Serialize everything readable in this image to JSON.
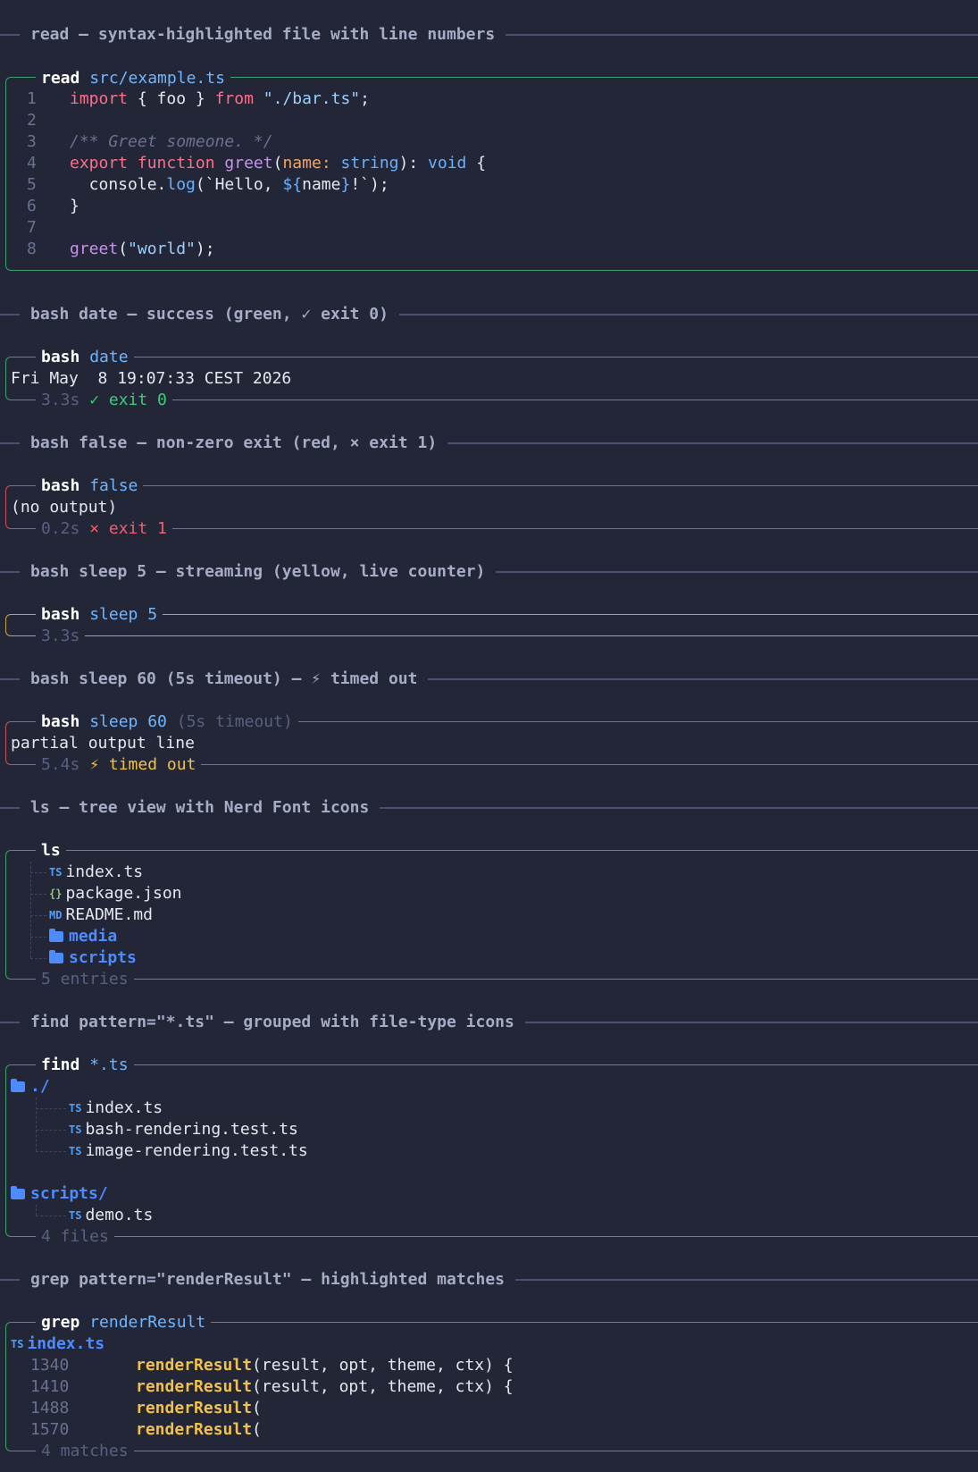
{
  "sections": {
    "read": "read — syntax-highlighted file with line numbers",
    "bash_date": "bash date — success (green, ✓ exit 0)",
    "bash_false": "bash false — non-zero exit (red, × exit 1)",
    "bash_sleep5": "bash sleep 5 — streaming (yellow, live counter)",
    "bash_sleep60": "bash sleep 60 (5s timeout) — ⚡ timed out",
    "ls": "ls — tree view with Nerd Font icons",
    "find": "find pattern=\"*.ts\" — grouped with file-type icons",
    "grep": "grep pattern=\"renderResult\" — highlighted matches"
  },
  "read_box": {
    "cmd": "read",
    "arg": "src/example.ts",
    "line_numbers": [
      "1",
      "2",
      "3",
      "4",
      "5",
      "6",
      "7",
      "8"
    ],
    "lines": {
      "l1_import": "import",
      "l1_mid": " { foo } ",
      "l1_from": "from",
      "l1_str": " \"./bar.ts\"",
      "l1_end": ";",
      "l3_comment": "/** Greet someone. */",
      "l4_export": "export",
      "l4_function": " function",
      "l4_name": " greet",
      "l4_open": "(",
      "l4_param": "name",
      "l4_colon": ": ",
      "l4_type": "string",
      "l4_close": "): ",
      "l4_void": "void",
      "l4_brace": " {",
      "l5_console": "  console.",
      "l5_log": "log",
      "l5_open": "(`Hello, ",
      "l5_interp_open": "${",
      "l5_interp": "name",
      "l5_interp_close": "}",
      "l5_rest": "!`);",
      "l6": "}",
      "l8_fn": "greet",
      "l8_open": "(",
      "l8_str": "\"world\"",
      "l8_end": ");"
    }
  },
  "bash_date_box": {
    "cmd": "bash",
    "arg": "date",
    "output": "Fri May  8 19:07:33 CEST 2026",
    "duration": "3.3s",
    "status": "✓ exit 0"
  },
  "bash_false_box": {
    "cmd": "bash",
    "arg": "false",
    "output": "(no output)",
    "duration": "0.2s",
    "status": "× exit 1"
  },
  "bash_sleep5_box": {
    "cmd": "bash",
    "arg": "sleep 5",
    "duration": "3.3s"
  },
  "bash_sleep60_box": {
    "cmd": "bash",
    "arg": "sleep 60",
    "note": "(5s timeout)",
    "output": "partial output line",
    "duration": "5.4s",
    "status": "⚡ timed out"
  },
  "ls_box": {
    "cmd": "ls",
    "items": [
      {
        "icon": "TS",
        "name": "index.ts"
      },
      {
        "icon": "{}",
        "name": "package.json"
      },
      {
        "icon": "MD",
        "name": "README.md"
      },
      {
        "icon": "",
        "name": "media"
      },
      {
        "icon": "",
        "name": "scripts"
      }
    ],
    "footer": "5 entries"
  },
  "find_box": {
    "cmd": "find",
    "arg": "*.ts",
    "groups": [
      {
        "dir": "./",
        "files": [
          "index.ts",
          "bash-rendering.test.ts",
          "image-rendering.test.ts"
        ]
      },
      {
        "dir": "scripts/",
        "files": [
          "demo.ts"
        ]
      }
    ],
    "icon": "TS",
    "footer": "4 files"
  },
  "grep_box": {
    "cmd": "grep",
    "arg": "renderResult",
    "file_icon": "TS",
    "file": "index.ts",
    "match_word": "renderResult",
    "matches": [
      {
        "line": "1340",
        "rest": "(result, opt, theme, ctx) {"
      },
      {
        "line": "1410",
        "rest": "(result, opt, theme, ctx) {"
      },
      {
        "line": "1488",
        "rest": "("
      },
      {
        "line": "1570",
        "rest": "("
      }
    ],
    "footer": "4 matches"
  },
  "colors": {
    "background": "#222637",
    "success": "#3fca7a",
    "error": "#ef5f6f",
    "warning": "#f0c14b",
    "accent": "#6fb6ff"
  }
}
